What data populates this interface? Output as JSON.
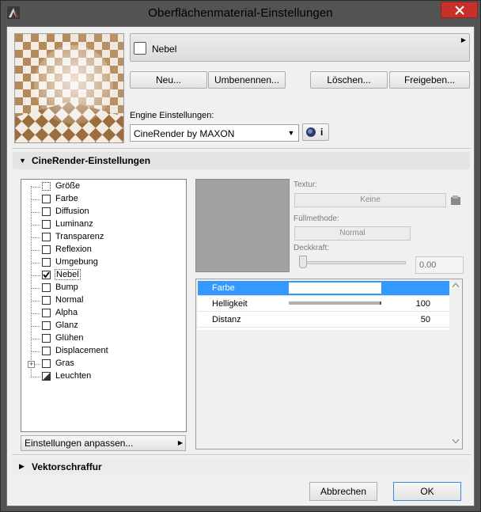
{
  "window": {
    "title": "Oberflächenmaterial-Einstellungen"
  },
  "material": {
    "name": "Nebel"
  },
  "actions": {
    "new": "Neu...",
    "rename": "Umbenennen...",
    "delete": "Löschen...",
    "share": "Freigeben..."
  },
  "engine": {
    "label": "Engine Einstellungen:",
    "selected": "CineRender by MAXON",
    "info_glyph": "i"
  },
  "sections": {
    "cinerender": "CineRender-Einstellungen",
    "vector": "Vektorschraffur"
  },
  "tree": {
    "items": [
      {
        "label": "Größe",
        "checked": false
      },
      {
        "label": "Farbe",
        "checked": false
      },
      {
        "label": "Diffusion",
        "checked": false
      },
      {
        "label": "Luminanz",
        "checked": false
      },
      {
        "label": "Transparenz",
        "checked": false
      },
      {
        "label": "Reflexion",
        "checked": false
      },
      {
        "label": "Umgebung",
        "checked": false
      },
      {
        "label": "Nebel",
        "checked": true
      },
      {
        "label": "Bump",
        "checked": false
      },
      {
        "label": "Normal",
        "checked": false
      },
      {
        "label": "Alpha",
        "checked": false
      },
      {
        "label": "Glanz",
        "checked": false
      },
      {
        "label": "Glühen",
        "checked": false
      },
      {
        "label": "Displacement",
        "checked": false
      },
      {
        "label": "Gras",
        "checked": false
      },
      {
        "label": "Leuchten",
        "checked": false
      }
    ],
    "customize_label": "Einstellungen anpassen..."
  },
  "texture": {
    "texture_label": "Textur:",
    "texture_value": "Keine",
    "fill_label": "Füllmethode:",
    "fill_value": "Normal",
    "opacity_label": "Deckkraft:",
    "opacity_value": "0.00"
  },
  "params": {
    "rows": [
      {
        "label": "Farbe",
        "value": ""
      },
      {
        "label": "Helligkeit",
        "value": "100",
        "level": 1.0
      },
      {
        "label": "Distanz",
        "value": "50"
      }
    ]
  },
  "footer": {
    "cancel": "Abbrechen",
    "ok": "OK"
  },
  "colors": {
    "selection": "#3399ff",
    "close": "#c7312b",
    "titlebar": "#535353"
  }
}
